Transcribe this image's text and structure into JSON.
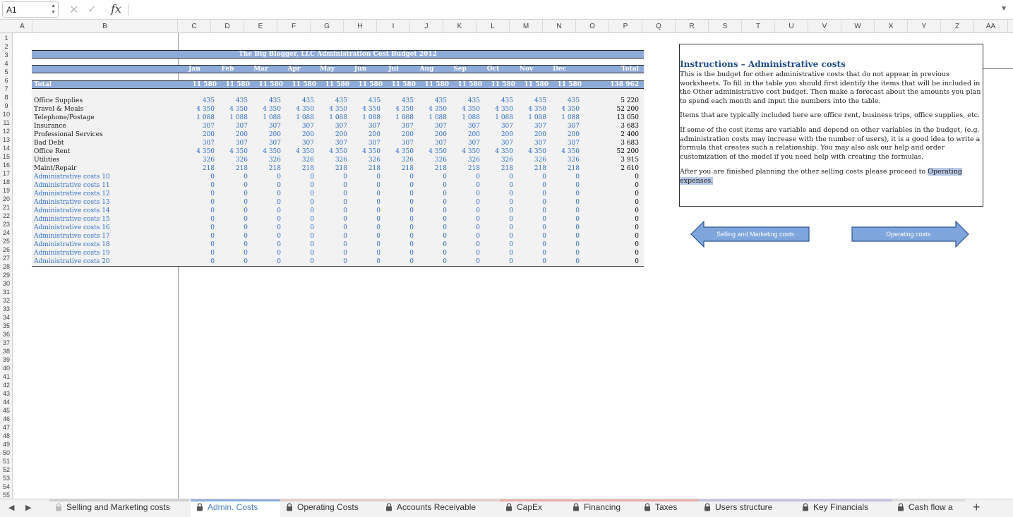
{
  "formula_bar": {
    "cell_ref": "A1",
    "formula": "",
    "fx_label": "fx"
  },
  "columns": [
    "A",
    "B",
    "C",
    "D",
    "E",
    "F",
    "G",
    "H",
    "I",
    "J",
    "K",
    "L",
    "M",
    "N",
    "O",
    "P",
    "Q",
    "R",
    "S",
    "T",
    "U",
    "V",
    "W",
    "X",
    "Y",
    "Z",
    "AA"
  ],
  "row_numbers": [
    "1",
    "2",
    "3",
    "4",
    "5",
    "6",
    "7",
    "8",
    "9",
    "10",
    "11",
    "12",
    "13",
    "14",
    "15",
    "16",
    "17",
    "18",
    "19",
    "20",
    "21",
    "22",
    "23",
    "24",
    "25",
    "26",
    "27",
    "28",
    "29",
    "30",
    "31",
    "32",
    "33",
    "34",
    "35",
    "36",
    "37",
    "38",
    "39",
    "40",
    "41",
    "42",
    "43",
    "44",
    "45",
    "46",
    "47",
    "48",
    "49",
    "50",
    "51",
    "52",
    "53",
    "54",
    "55"
  ],
  "budget": {
    "title": "The Big Blogger, LLC Administration Cost Budget 2012",
    "months": [
      "Jan",
      "Feb",
      "Mar",
      "Apr",
      "May",
      "Jun",
      "Jul",
      "Aug",
      "Sep",
      "Oct",
      "Nov",
      "Dec"
    ],
    "total_header": "Total",
    "total_row": {
      "label": "Total",
      "values": [
        "11 580",
        "11 580",
        "11 580",
        "11 580",
        "11 580",
        "11 580",
        "11 580",
        "11 580",
        "11 580",
        "11 580",
        "11 580",
        "11 580"
      ],
      "total": "138 962"
    },
    "rows": [
      {
        "label": "Office Supplies",
        "value": "435",
        "total": "5 220",
        "blue_label": false
      },
      {
        "label": "Travel & Meals",
        "value": "4 350",
        "total": "52 200",
        "blue_label": false
      },
      {
        "label": "Telephone/Postage",
        "value": "1 088",
        "total": "13 050",
        "blue_label": false
      },
      {
        "label": "Insurance",
        "value": "307",
        "total": "3 683",
        "blue_label": false
      },
      {
        "label": "Professional Services",
        "value": "200",
        "total": "2 400",
        "blue_label": false
      },
      {
        "label": "Bad Debt",
        "value": "307",
        "total": "3 683",
        "blue_label": false
      },
      {
        "label": "Office Rent",
        "value": "4 350",
        "total": "52 200",
        "blue_label": false
      },
      {
        "label": "Utilities",
        "value": "326",
        "total": "3 915",
        "blue_label": false
      },
      {
        "label": "Maint/Repair",
        "value": "218",
        "total": "2 610",
        "blue_label": false
      },
      {
        "label": "Administrative costs 10",
        "value": "0",
        "total": "0",
        "blue_label": true
      },
      {
        "label": "Administrative costs 11",
        "value": "0",
        "total": "0",
        "blue_label": true
      },
      {
        "label": "Administrative costs 12",
        "value": "0",
        "total": "0",
        "blue_label": true
      },
      {
        "label": "Administrative costs 13",
        "value": "0",
        "total": "0",
        "blue_label": true
      },
      {
        "label": "Administrative costs 14",
        "value": "0",
        "total": "0",
        "blue_label": true
      },
      {
        "label": "Administrative costs 15",
        "value": "0",
        "total": "0",
        "blue_label": true
      },
      {
        "label": "Administrative costs 16",
        "value": "0",
        "total": "0",
        "blue_label": true
      },
      {
        "label": "Administrative costs 17",
        "value": "0",
        "total": "0",
        "blue_label": true
      },
      {
        "label": "Administrative costs 18",
        "value": "0",
        "total": "0",
        "blue_label": true
      },
      {
        "label": "Administrative costs 19",
        "value": "0",
        "total": "0",
        "blue_label": true
      },
      {
        "label": "Administrative costs 20",
        "value": "0",
        "total": "0",
        "blue_label": true
      }
    ]
  },
  "instructions": {
    "title": "Instructions – Administrative costs",
    "p1": "This is the budget for other administrative costs that do not appear in previous worksheets. To fill in the table you should first identify the items that will be included in the Other administrative cost budget. Then make a forecast about the amounts you plan to spend each month and input the numbers into the table.",
    "p2": "Items that are typically included here are office rent, business trips, office supplies, etc.",
    "p3": "If some of the cost items are variable and depend on other variables in the budget, (e.g. administration costs may increase with the number of users), it is a good idea to write a formula that creates such a relationship. You may also ask our help and order customization of the model if you need help with creating the formulas.",
    "p4_prefix": "After you are finished planning the other selling costs please proceed to ",
    "p4_link": "Operating expenses."
  },
  "nav": {
    "prev_label": "Selling and Marketing costs",
    "next_label": "Operating costs",
    "fill_color": "#7ea6dc",
    "border_color": "#2f5597"
  },
  "sheet_tabs": [
    {
      "label": "Selling and Marketing costs",
      "active": false,
      "color": "#d0d0d0"
    },
    {
      "label": "Admin. Costs",
      "active": true,
      "color": "#8fb0dc"
    },
    {
      "label": "Operating Costs",
      "active": false,
      "color": "#e8cfcf"
    },
    {
      "label": "Accounts Receivable",
      "active": false,
      "color": "#e8cfcf"
    },
    {
      "label": "CapEx",
      "active": false,
      "color": "#e8b0a8"
    },
    {
      "label": "Financing",
      "active": false,
      "color": "#e8b0a8"
    },
    {
      "label": "Taxes",
      "active": false,
      "color": "#e8b0a8"
    },
    {
      "label": "Users structure",
      "active": false,
      "color": "#c8c0e0"
    },
    {
      "label": "Key Financials",
      "active": false,
      "color": "#c8c0e0"
    },
    {
      "label": "Cash flow a",
      "active": false,
      "color": "#dddddd"
    }
  ],
  "colors": {
    "header_blue": "#8eaad8",
    "value_blue": "#2e6fc7",
    "grid_gray": "#f2f2f2",
    "active_tab": "#4a7fc1"
  }
}
